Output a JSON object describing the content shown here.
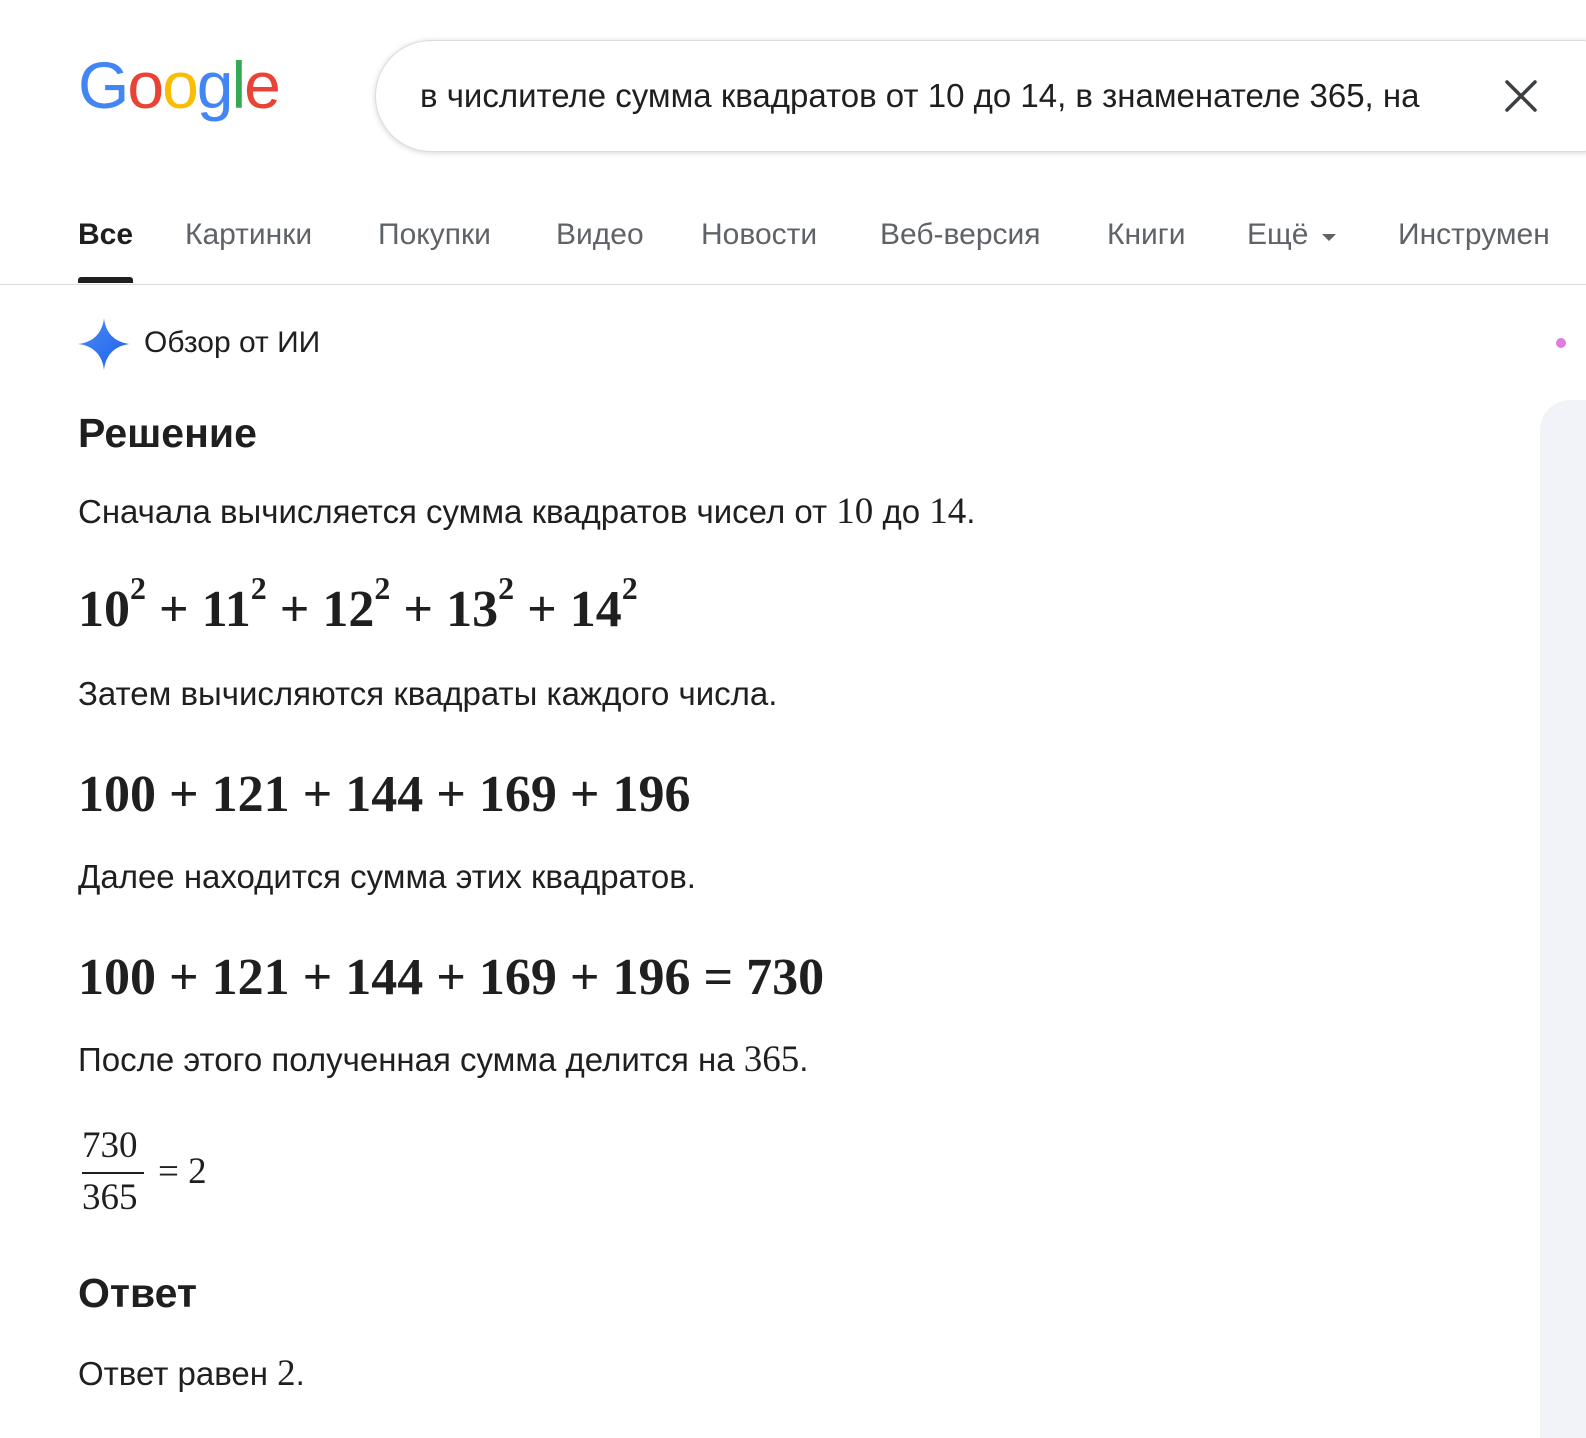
{
  "logo": {
    "letters": [
      "G",
      "o",
      "o",
      "g",
      "l",
      "e"
    ],
    "colors": [
      "#4285F4",
      "#EA4335",
      "#FBBC05",
      "#4285F4",
      "#34A853",
      "#EA4335"
    ]
  },
  "search": {
    "query": "в числителе сумма квадратов от 10 до 14, в знаменателе 365, на",
    "clear_icon": "close-icon"
  },
  "tabs": {
    "items": [
      "Все",
      "Картинки",
      "Покупки",
      "Видео",
      "Новости",
      "Веб-версия",
      "Книги",
      "Ещё",
      "Инструмен"
    ],
    "active": "Все"
  },
  "ai_overview": {
    "icon": "sparkle-icon",
    "title": "Обзор от ИИ",
    "solution_heading": "Решение",
    "step1_text": "Сначала вычисляется сумма квадратов чисел от",
    "step1_from": "10",
    "step1_to_word": "до",
    "step1_to": "14",
    "step1_end": ".",
    "squares": {
      "bases": [
        "10",
        "11",
        "12",
        "13",
        "14"
      ],
      "exponent": "2",
      "operator": "+"
    },
    "step2_text": "Затем вычисляются квадраты каждого числа.",
    "expr_values": "100 + 121 + 144 + 169 + 196",
    "step3_text": "Далее находится сумма этих квадратов.",
    "expr_sum": "100 + 121 + 144 + 169 + 196 = 730",
    "step4_text": "После этого полученная сумма делится на",
    "step4_num": "365",
    "step4_end": ".",
    "fraction": {
      "numerator": "730",
      "denominator": "365",
      "result": "= 2"
    },
    "answer_heading": "Ответ",
    "answer_text": "Ответ равен",
    "answer_value": "2",
    "answer_end": "."
  }
}
